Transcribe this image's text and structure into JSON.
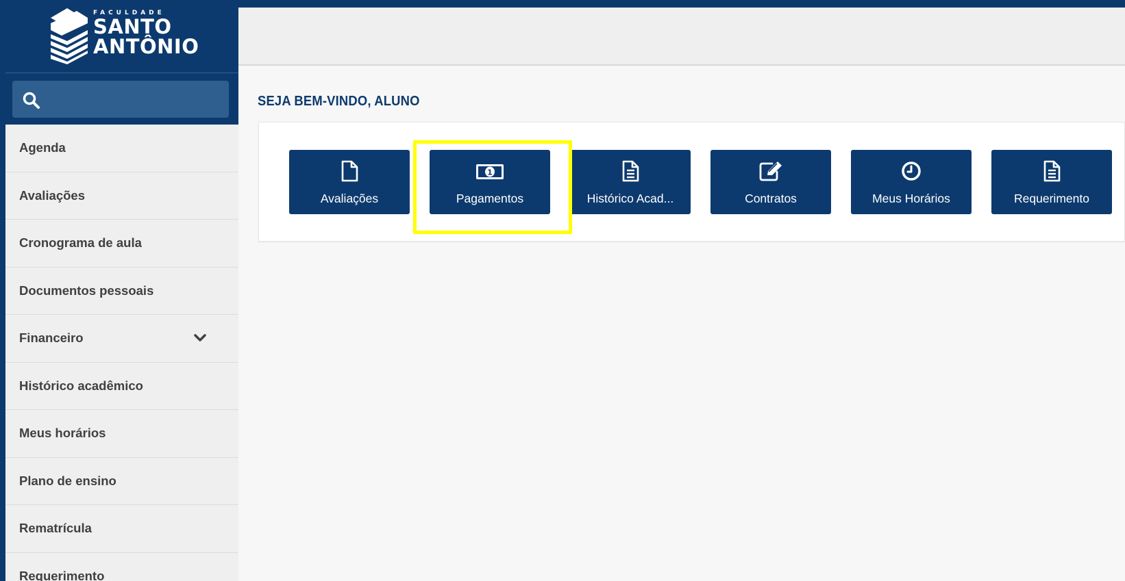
{
  "brand": {
    "small_text": "FACULDADE",
    "line1": "SANTO",
    "line2": "ANTÔNIO"
  },
  "sidebar": {
    "items": [
      {
        "label": "Agenda"
      },
      {
        "label": "Avaliações"
      },
      {
        "label": "Cronograma de aula"
      },
      {
        "label": "Documentos pessoais"
      },
      {
        "label": "Financeiro",
        "has_dropdown": true
      },
      {
        "label": "Histórico acadêmico"
      },
      {
        "label": "Meus horários"
      },
      {
        "label": "Plano de ensino"
      },
      {
        "label": "Rematrícula"
      },
      {
        "label": "Requerimento"
      }
    ]
  },
  "main": {
    "welcome": "SEJA BEM-VINDO, ALUNO",
    "tiles": [
      {
        "label": "Avaliações",
        "icon": "file-icon"
      },
      {
        "label": "Pagamentos",
        "icon": "money-bill-icon",
        "highlighted": true
      },
      {
        "label": "Histórico Acad...",
        "icon": "document-lines-icon"
      },
      {
        "label": "Contratos",
        "icon": "edit-icon"
      },
      {
        "label": "Meus Horários",
        "icon": "clock-icon"
      },
      {
        "label": "Requerimento",
        "icon": "document-lines-icon"
      }
    ]
  },
  "colors": {
    "primary": "#0d3a6e",
    "highlight": "#ffff00",
    "sidebar_bg": "#efefef",
    "content_bg": "#f7f7f7"
  }
}
